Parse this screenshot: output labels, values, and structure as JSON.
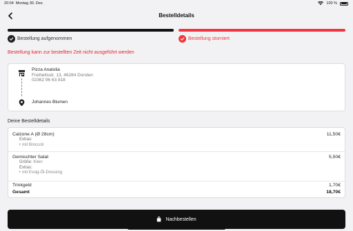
{
  "status_bar": {
    "time": "20:04",
    "date": "Montag 30. Dez.",
    "battery": "100 %"
  },
  "header": {
    "title": "Bestelldetails"
  },
  "progress": {
    "step1_label": "Bestellung aufgenommen",
    "step2_label": "Bestellung storniert",
    "step1_color": "#111111",
    "step2_color": "#f1353e"
  },
  "cancel_note": "Bestellung kann zur bestellten Zeit nicht ausgeführt werden",
  "restaurant": {
    "name": "Pizza Anatolia",
    "address": "Freiheitsstr. 13, 46284 Dorsten",
    "phone": "02362 96 63 818",
    "icon": "shop-icon"
  },
  "customer": {
    "name": "Johannes Blumen",
    "icon": "location-pin-icon"
  },
  "order": {
    "section_title": "Deine Bestelldetails",
    "items": [
      {
        "name": "Calzone A (Ø 28cm)",
        "price": "11,50€",
        "extras_label": "Extras:",
        "extra": "+ mit Broccoli"
      },
      {
        "name": "Gemischter Salat",
        "price": "5,50€",
        "size_label": "Größe:",
        "size_value": "Klein",
        "extras_label": "Extras:",
        "extra": "+ mit Essig-Öl-Dressing"
      }
    ],
    "tip_label": "Trinkgeld",
    "tip_value": "1,70€",
    "total_label": "Gesamt",
    "total_value": "18,70€"
  },
  "reorder_button": {
    "label": "Nachbestellen",
    "icon": "shopping-bag-icon"
  },
  "accent_color": "#e8232c"
}
